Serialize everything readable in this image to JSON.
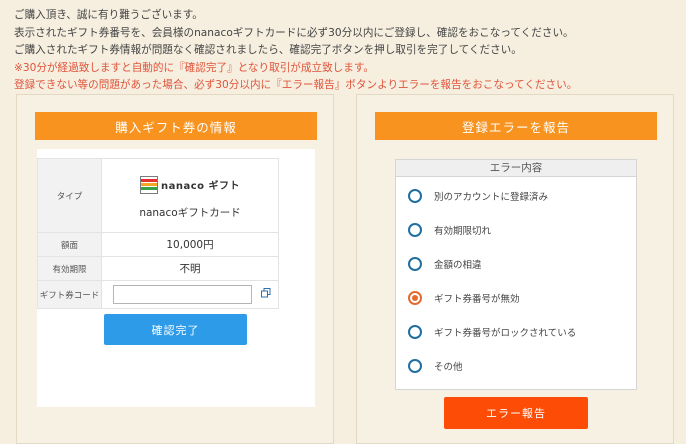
{
  "notice": {
    "line1": "ご購入頂き、誠に有り難うございます。",
    "line2": "表示されたギフト券番号を、会員様のnanacoギフトカードに必ず30分以内にご登録し、確認をおこなってください。",
    "line3": "ご購入されたギフト券情報が問題なく確認されましたら、確認完了ボタンを押し取引を完了してください。",
    "line4": "※30分が経過致しますと自動的に『確認完了』となり取引が成立致します。",
    "line5": "登録できない等の問題があった場合、必ず30分以内に『エラー報告』ボタンよりエラーを報告をおこなってください。"
  },
  "gift_info": {
    "title": "購入ギフト券の情報",
    "type_label": "タイプ",
    "logo_text": "nanaco ギフト",
    "type_value": "nanacoギフトカード",
    "amount_label": "額面",
    "amount_value": "10,000円",
    "expiry_label": "有効期限",
    "expiry_value": "不明",
    "code_label": "ギフト券コード",
    "code_value": "",
    "confirm_button": "確認完了"
  },
  "error_report": {
    "title": "登録エラーを報告",
    "box_header": "エラー内容",
    "options": [
      {
        "label": "別のアカウントに登録済み",
        "selected": false
      },
      {
        "label": "有効期限切れ",
        "selected": false
      },
      {
        "label": "金額の相違",
        "selected": false
      },
      {
        "label": "ギフト券番号が無効",
        "selected": true
      },
      {
        "label": "ギフト券番号がロックされている",
        "selected": false
      },
      {
        "label": "その他",
        "selected": false
      }
    ],
    "report_button": "エラー報告"
  },
  "colors": {
    "accent_orange": "#f7931e",
    "confirm_blue": "#2e9be9",
    "report_red": "#fd4c05",
    "notice_red": "#e0533a",
    "radio_blue": "#1f6fa0",
    "radio_selected": "#e46a2e"
  },
  "icons": {
    "copy": "copy-icon",
    "logo": "nanaco-logo-icon"
  }
}
